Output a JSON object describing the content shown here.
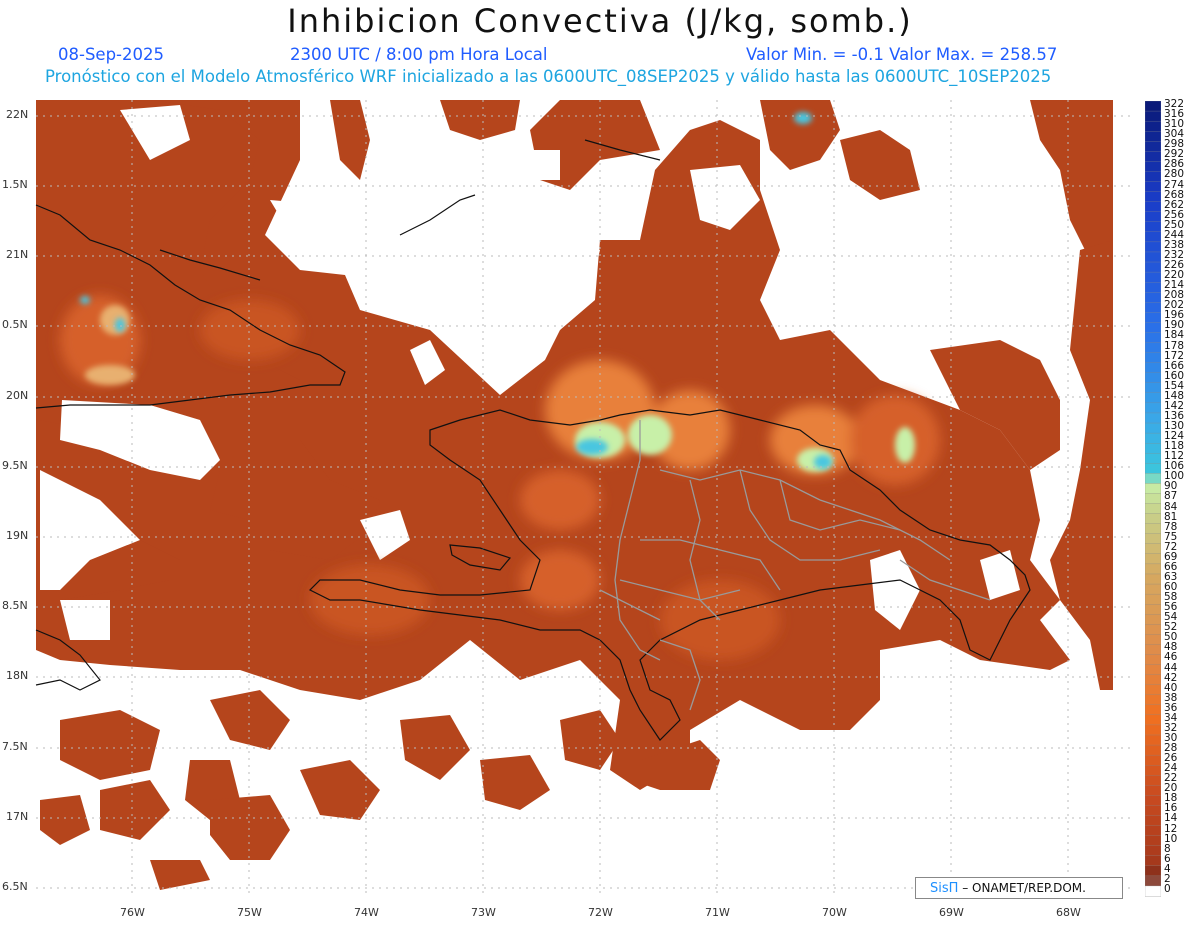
{
  "header": {
    "title": "Inhibicion Convectiva (J/kg, somb.)",
    "date": "08-Sep-2025",
    "time": "2300 UTC / 8:00 pm Hora Local",
    "minmax": "Valor Min. = -0.1  Valor Max. = 258.57",
    "forecast": "Pronóstico con el Modelo Atmosférico WRF inicializado a las 0600UTC_08SEP2025 y válido hasta las  0600UTC_10SEP2025"
  },
  "axes": {
    "lat_labels": [
      "22N",
      "1.5N",
      "21N",
      "0.5N",
      "20N",
      "9.5N",
      "19N",
      "8.5N",
      "18N",
      "7.5N",
      "17N",
      "6.5N"
    ],
    "lon_labels": [
      "76W",
      "75W",
      "74W",
      "73W",
      "72W",
      "71W",
      "70W",
      "69W",
      "68W"
    ]
  },
  "colorbar": {
    "labels": [
      "322",
      "316",
      "310",
      "304",
      "298",
      "292",
      "286",
      "280",
      "274",
      "268",
      "262",
      "256",
      "250",
      "244",
      "238",
      "232",
      "226",
      "220",
      "214",
      "208",
      "202",
      "196",
      "190",
      "184",
      "178",
      "172",
      "166",
      "160",
      "154",
      "148",
      "142",
      "136",
      "130",
      "124",
      "118",
      "112",
      "106",
      "100",
      "90",
      "87",
      "84",
      "81",
      "78",
      "75",
      "72",
      "69",
      "66",
      "63",
      "60",
      "58",
      "56",
      "54",
      "52",
      "50",
      "48",
      "46",
      "44",
      "42",
      "40",
      "38",
      "36",
      "34",
      "32",
      "30",
      "28",
      "26",
      "24",
      "22",
      "20",
      "18",
      "16",
      "14",
      "12",
      "10",
      "8",
      "6",
      "4",
      "2",
      "0"
    ],
    "colors": {
      "high": "#0a1a7a",
      "blue": "#2a6fe8",
      "cyan": "#3cc8dc",
      "pale_green": "#c8f0a8",
      "tan": "#d6a860",
      "orange": "#f07020",
      "red_brown": "#a83a1c",
      "dark": "#7a2a1a",
      "zero": "#ffffff"
    }
  },
  "credit": {
    "brand": "SisΠ",
    "org": " – ONAMET/REP.DOM."
  },
  "field_colors": {
    "base": "#b5451c",
    "dark": "#9a3418",
    "light": "#d6602a",
    "warm": "#e8803a",
    "pale": "#c8f0a8",
    "cyan": "#48c6e0"
  }
}
